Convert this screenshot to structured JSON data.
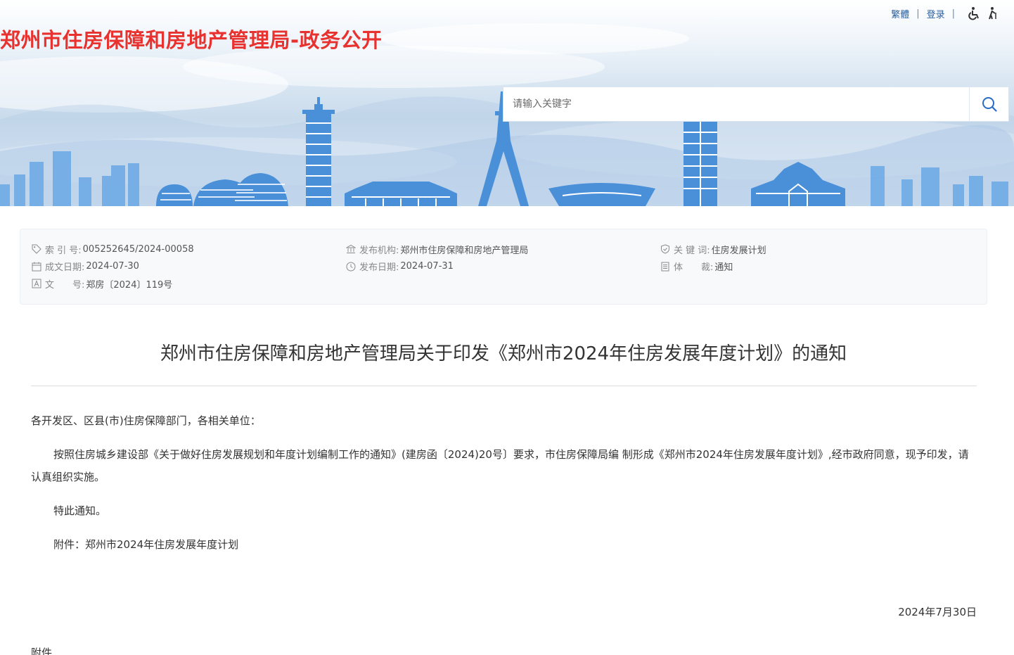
{
  "header": {
    "site_title": "郑州市住房保障和房地产管理局-政务公开",
    "links": {
      "traditional": "繁體",
      "login": "登录"
    },
    "accessibility_icons": [
      "wheelchair-icon",
      "elderly-icon"
    ],
    "search": {
      "placeholder": "请输入关键字",
      "icon": "search-icon"
    }
  },
  "meta": {
    "index_no": {
      "label": "索 引 号:",
      "value": "005252645/2024-00058",
      "icon": "tag-icon"
    },
    "written": {
      "label": "成文日期:",
      "value": "2024-07-30",
      "icon": "calendar-icon"
    },
    "doc_no": {
      "label": "文　　号:",
      "value": "郑房〔2024〕119号",
      "icon": "document-number-icon"
    },
    "publisher": {
      "label": "发布机构:",
      "value": "郑州市住房保障和房地产管理局",
      "icon": "institution-icon"
    },
    "published": {
      "label": "发布日期:",
      "value": "2024-07-31",
      "icon": "clock-icon"
    },
    "keywords": {
      "label": "关 键 词:",
      "value": "住房发展计划",
      "icon": "shield-icon"
    },
    "genre": {
      "label": "体　　裁:",
      "value": "通知",
      "icon": "list-icon"
    }
  },
  "article": {
    "title": "郑州市住房保障和房地产管理局关于印发《郑州市2024年住房发展年度计划》的通知",
    "greeting": "各开发区、区县(市)住房保障部门，各相关单位：",
    "paragraph1": "按照住房城乡建设部《关于做好住房发展规划和年度计划编制工作的通知》(建房函〔2024)20号〕要求，市住房保障局编 制形成《郑州市2024年住房发展年度计划》,经市政府同意，现予印发，请认真组织实施。",
    "paragraph2": "特此通知。",
    "attachment": "附件：郑州市2024年住房发展年度计划",
    "date": "2024年7月30日",
    "tail": "附件"
  },
  "colors": {
    "title_red": "#e8322f",
    "link_blue": "#2a5e9c",
    "skyline_blue": "#4a90d9"
  }
}
